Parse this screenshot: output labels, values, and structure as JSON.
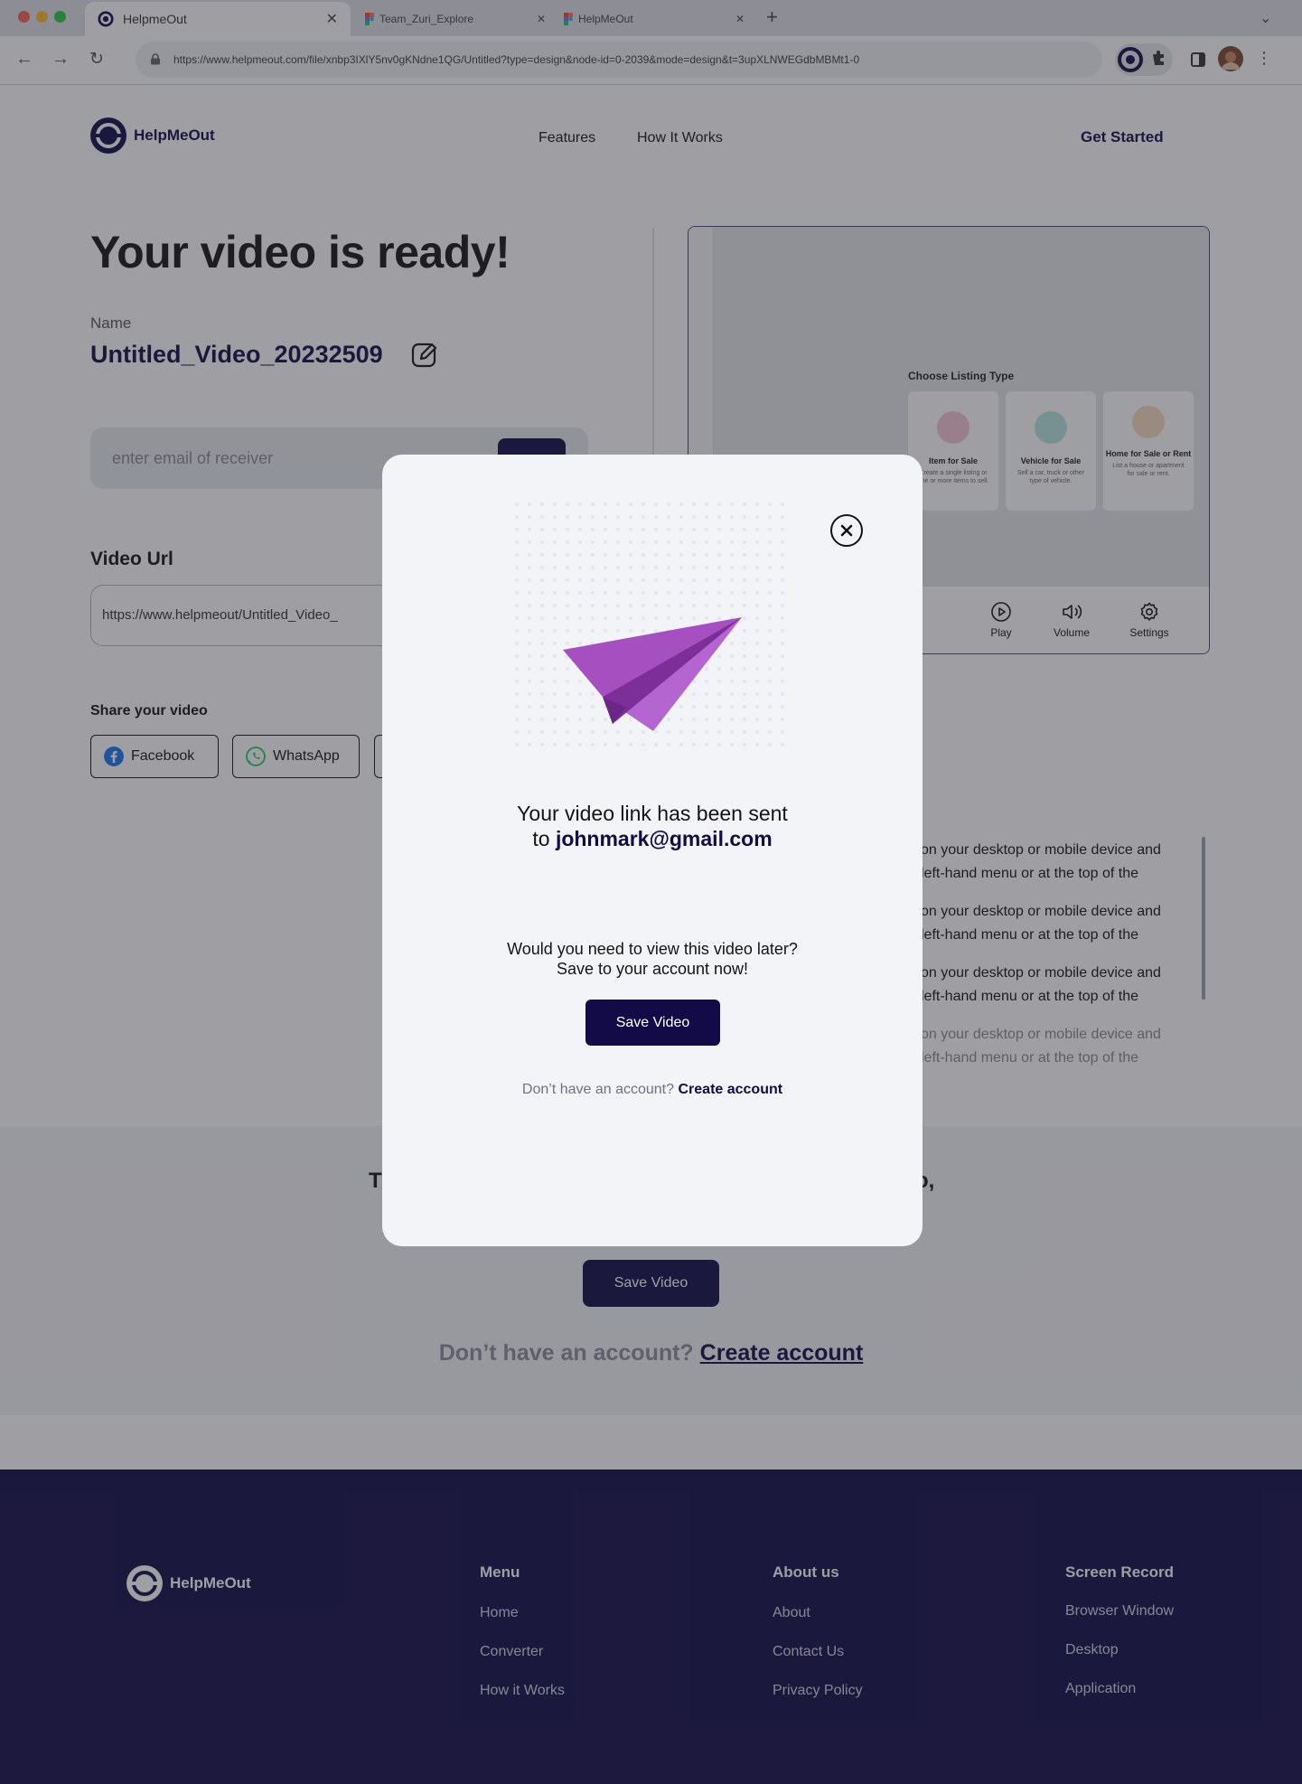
{
  "browser": {
    "tabs": [
      {
        "title": "HelpmeOut",
        "active": true
      },
      {
        "title": "Team_Zuri_Explore",
        "active": false
      },
      {
        "title": "HelpMeOut",
        "active": false
      }
    ],
    "url": "https://www.helpmeout.com/file/xnbp3IXlY5nv0gKNdne1QG/Untitled?type=design&node-id=0-2039&mode=design&t=3upXLNWEGdbMBMt1-0"
  },
  "header": {
    "brand": "HelpMeOut",
    "nav": [
      "Features",
      "How It Works"
    ],
    "cta": "Get Started"
  },
  "main": {
    "title": "Your video is ready!",
    "name_label": "Name",
    "name_value": "Untitled_Video_20232509",
    "email_placeholder": "enter email of receiver",
    "video_url_label": "Video Url",
    "video_url": "https://www.helpmeout/Untitled_Video_",
    "share_label": "Share your video",
    "share_buttons": [
      "Facebook",
      "WhatsApp"
    ]
  },
  "preview": {
    "listing_title": "Choose Listing Type",
    "cards": [
      {
        "title": "Item for Sale",
        "desc": "Create a single listing or one or more items to sell."
      },
      {
        "title": "Vehicle for Sale",
        "desc": "Sell a car, truck or other type of vehicle."
      },
      {
        "title": "Home for Sale or Rent",
        "desc": "List a house or apartment for sale or rent."
      }
    ],
    "controls": [
      "Play",
      "Volume",
      "Settings"
    ]
  },
  "transcript": {
    "lines": [
      "on your desktop or mobile device and",
      "left-hand menu or at the top of the",
      "on your desktop or mobile device and",
      "left-hand menu or at the top of the",
      "on your desktop or mobile device and",
      "left-hand menu or at the top of the",
      "on your desktop or mobile device and",
      "left-hand menu or at the top of the"
    ]
  },
  "save_section": {
    "heading_left": "T",
    "heading_right": "o,",
    "button": "Save Video",
    "no_account": "Don’t have an account?",
    "create_account": "Create account"
  },
  "footer": {
    "brand": "HelpMeOut",
    "columns": [
      {
        "heading": "Menu",
        "items": [
          "Home",
          "Converter",
          "How it Works"
        ]
      },
      {
        "heading": "About us",
        "items": [
          "About",
          "Contact Us",
          "Privacy Policy"
        ]
      },
      {
        "heading": "Screen Record",
        "items": [
          "Browser Window",
          "Desktop",
          "Application"
        ]
      }
    ]
  },
  "modal": {
    "sent_line1": "Your video link has been sent",
    "sent_prefix": "to",
    "sent_email": "johnmark@gmail.com",
    "later_line1": "Would you need to view this video later?",
    "later_line2": "Save to your account now!",
    "save_button": "Save Video",
    "no_account": "Don’t have an account?",
    "create_account": "Create account"
  },
  "colors": {
    "brand_navy": "#120b48",
    "plane_purple": "#a64fc0"
  }
}
